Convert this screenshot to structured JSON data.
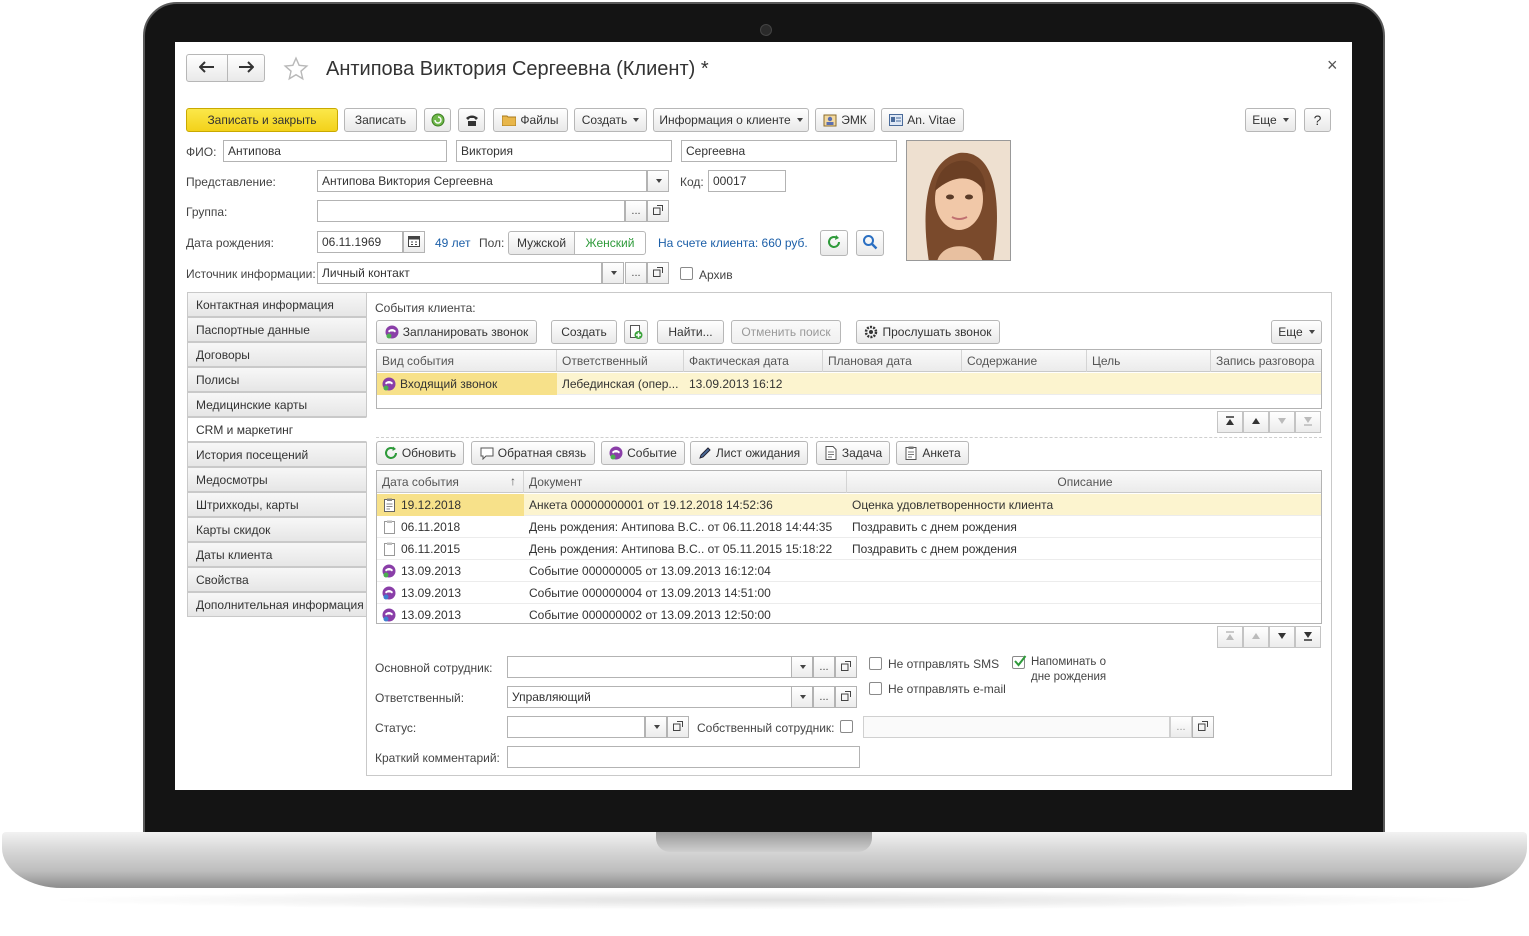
{
  "window": {
    "title": "Антипова Виктория Сергеевна (Клиент) *",
    "close": "×"
  },
  "toolbar": {
    "save_close": "Записать и закрыть",
    "save": "Записать",
    "files": "Файлы",
    "create": "Создать",
    "client_info": "Информация о клиенте",
    "emk": "ЭМК",
    "an_vitae": "An. Vitae",
    "more": "Еще",
    "help": "?"
  },
  "form": {
    "fio_label": "ФИО:",
    "last_name": "Антипова",
    "first_name": "Виктория",
    "middle_name": "Сергеевна",
    "representation_label": "Представление:",
    "representation": "Антипова Виктория Сергеевна",
    "code_label": "Код:",
    "code": "00017",
    "group_label": "Группа:",
    "group": "",
    "birth_label": "Дата рождения:",
    "birth_date": "06.11.1969",
    "age": "49 лет",
    "sex_label": "Пол:",
    "sex_male": "Мужской",
    "sex_female": "Женский",
    "balance": "На счете клиента: 660 руб.",
    "source_label": "Источник информации:",
    "source": "Личный контакт",
    "archive_label": "Архив",
    "ellipsis": "..."
  },
  "sidebar": {
    "items": [
      "Контактная информация",
      "Паспортные данные",
      "Договоры",
      "Полисы",
      "Медицинские карты",
      "CRM и маркетинг",
      "История посещений",
      "Медосмотры",
      "Штрихкоды, карты",
      "Карты скидок",
      "Даты клиента",
      "Свойства",
      "Дополнительная информация"
    ],
    "active_index": 5
  },
  "events": {
    "title": "События клиента:",
    "btn_plan_call": "Запланировать звонок",
    "btn_create": "Создать",
    "btn_find": "Найти...",
    "btn_cancel_search": "Отменить поиск",
    "btn_listen": "Прослушать звонок",
    "btn_more": "Еще",
    "columns": [
      "Вид события",
      "Ответственный",
      "Фактическая дата",
      "Плановая дата",
      "Содержание",
      "Цель",
      "Запись разговора"
    ],
    "rows": [
      {
        "type": "Входящий звонок",
        "responsible": "Лебединская (опер...",
        "actual": "13.09.2013 16:12",
        "planned": "",
        "content": "",
        "goal": "",
        "record": ""
      }
    ]
  },
  "history": {
    "btn_refresh": "Обновить",
    "btn_feedback": "Обратная связь",
    "btn_event": "Событие",
    "btn_waitlist": "Лист ожидания",
    "btn_task": "Задача",
    "btn_survey": "Анкета",
    "columns": [
      "Дата события",
      "Документ",
      "Описание"
    ],
    "sort_mark": "↑",
    "rows": [
      {
        "date": "19.12.2018",
        "doc": "Анкета 00000000001 от 19.12.2018 14:52:36",
        "desc": "Оценка удовлетворенности клиента",
        "icon": "survey"
      },
      {
        "date": "06.11.2018",
        "doc": "День рождения: Антипова В.С.. от 06.11.2018 14:44:35",
        "desc": "Поздравить с днем рождения",
        "icon": "doc"
      },
      {
        "date": "06.11.2015",
        "doc": "День рождения: Антипова В.С.. от 05.11.2015 15:18:22",
        "desc": "Поздравить с днем рождения",
        "icon": "doc"
      },
      {
        "date": "13.09.2013",
        "doc": "Событие 000000005 от 13.09.2013 16:12:04",
        "desc": "",
        "icon": "phone"
      },
      {
        "date": "13.09.2013",
        "doc": "Событие 000000004 от 13.09.2013 14:51:00",
        "desc": "",
        "icon": "phone"
      },
      {
        "date": "13.09.2013",
        "doc": "Событие 000000002 от 13.09.2013 12:50:00",
        "desc": "",
        "icon": "phone"
      }
    ]
  },
  "bottom": {
    "main_employee_label": "Основной сотрудник:",
    "main_employee": "",
    "responsible_label": "Ответственный:",
    "responsible": "Управляющий",
    "status_label": "Статус:",
    "status": "",
    "own_employee_label": "Собственный сотрудник:",
    "comment_label": "Краткий комментарий:",
    "comment": "",
    "no_sms": "Не отправлять SMS",
    "no_email": "Не отправлять e-mail",
    "remind_line1": "Напоминать о",
    "remind_line2": "дне рождения"
  },
  "colors": {
    "accent_yellow": "#f5d91f",
    "selection": "#fcf4cf",
    "link": "#1c5fa8",
    "female_green": "#2e9a3a"
  }
}
